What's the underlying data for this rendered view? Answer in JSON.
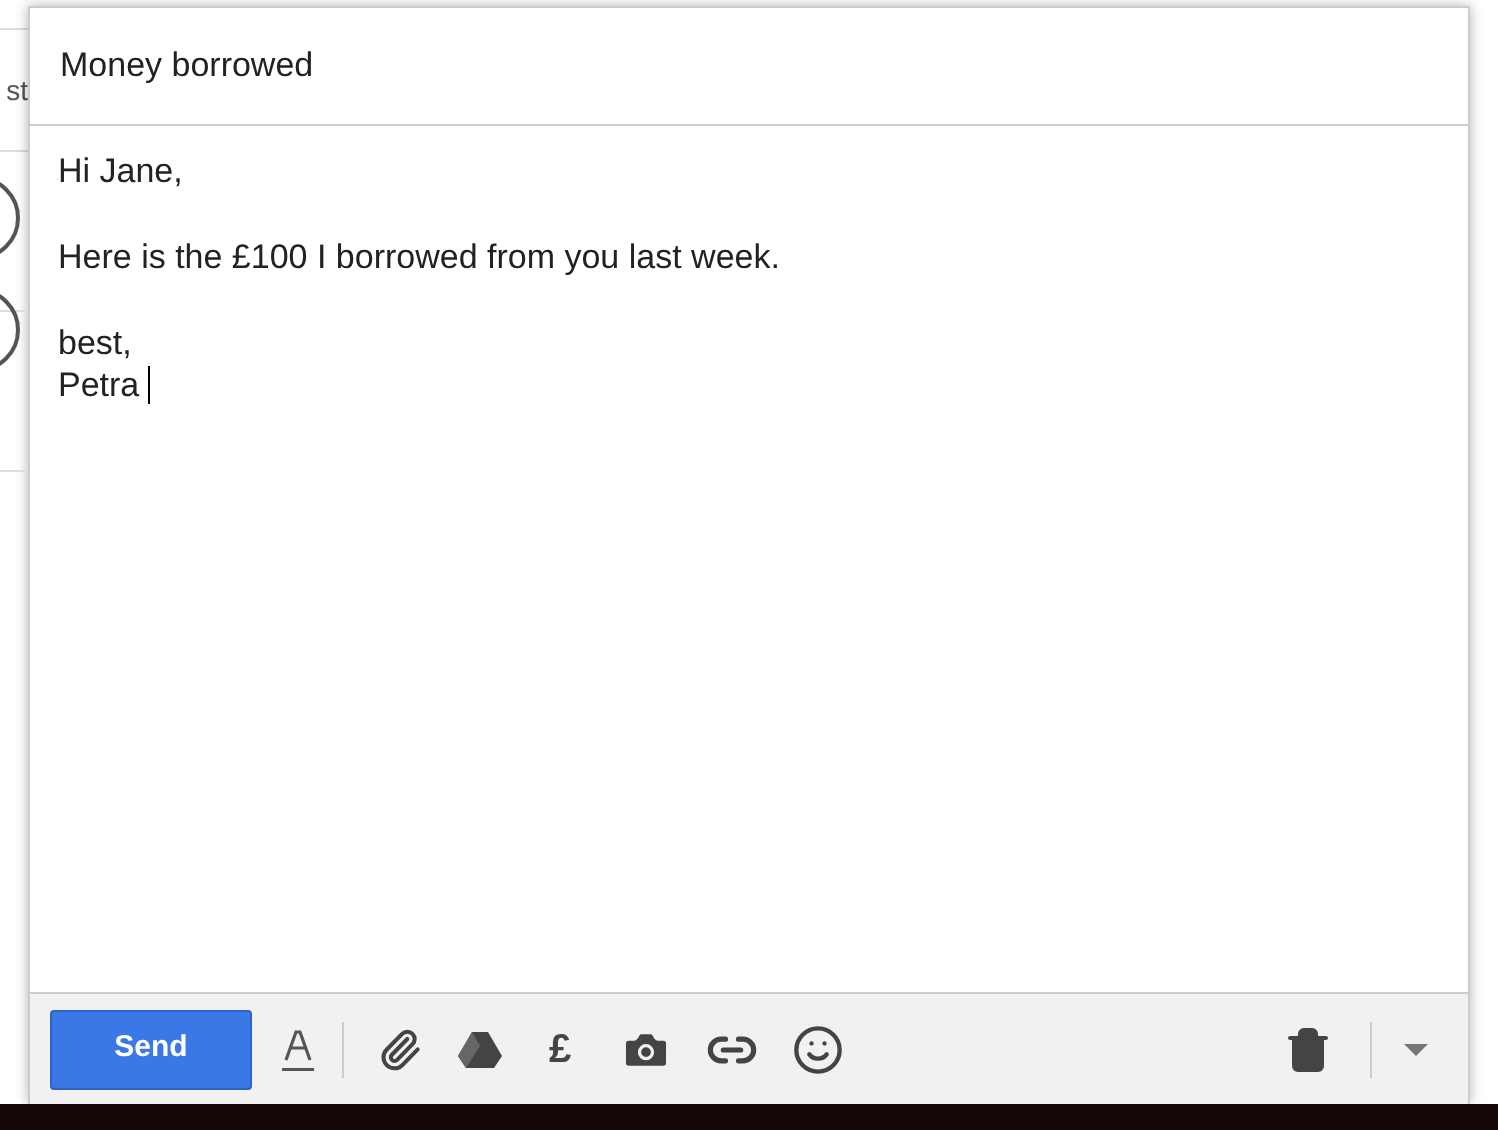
{
  "background": {
    "fragment": "st"
  },
  "compose": {
    "subject": "Money borrowed",
    "body": [
      [
        "Hi Jane,"
      ],
      [
        "Here is the £100 I borrowed from you last week."
      ],
      [
        "best,",
        "Petra"
      ]
    ],
    "send_button": "Send",
    "currency_button": "£"
  }
}
